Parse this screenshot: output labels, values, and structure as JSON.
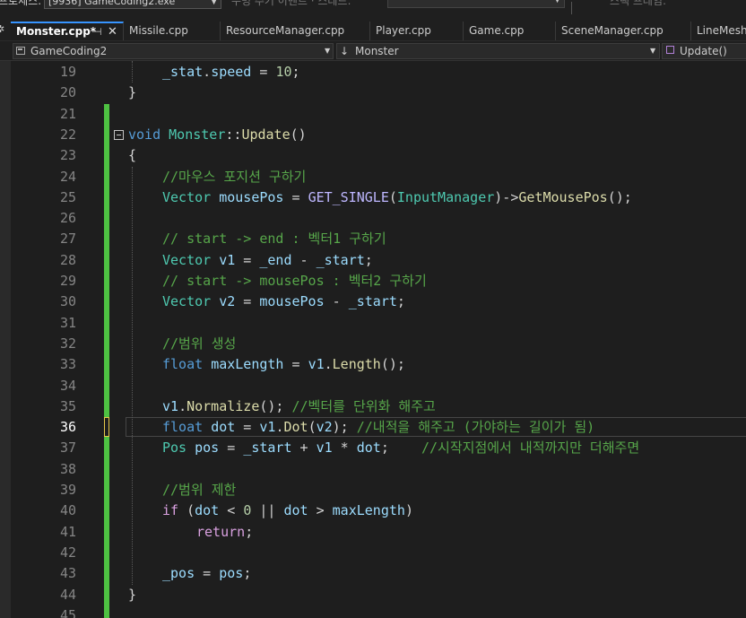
{
  "toolbar": {
    "process_label": "프로세스:",
    "process_value": "[9936] GameCoding2.exe",
    "lifecycle_label": "수명 주기 이벤트 · 스레드:",
    "stack_frame_label": "스택 프레임:"
  },
  "tabs": [
    {
      "label": "Monster.cpp*",
      "active": true
    },
    {
      "label": "Missile.cpp"
    },
    {
      "label": "ResourceManager.cpp"
    },
    {
      "label": "Player.cpp"
    },
    {
      "label": "Game.cpp"
    },
    {
      "label": "SceneManager.cpp"
    },
    {
      "label": "LineMesh."
    }
  ],
  "navbar": {
    "project": "GameCoding2",
    "scope": "Monster",
    "member": "Update()"
  },
  "editor": {
    "current_line": 36,
    "lines": [
      {
        "n": "19",
        "tokens": [
          [
            "var",
            "_stat"
          ],
          [
            "pl",
            "."
          ],
          [
            "var",
            "speed"
          ],
          [
            "pl",
            " = "
          ],
          [
            "num",
            "10"
          ],
          [
            "pl",
            ";"
          ]
        ],
        "indent": 1
      },
      {
        "n": "20",
        "tokens": [
          [
            "pl",
            "}"
          ]
        ],
        "indent": 0
      },
      {
        "n": "21",
        "tokens": [],
        "indent": 0
      },
      {
        "n": "22",
        "tokens": [
          [
            "kw",
            "void"
          ],
          [
            "pl",
            " "
          ],
          [
            "ty",
            "Monster"
          ],
          [
            "pl",
            "::"
          ],
          [
            "fn",
            "Update"
          ],
          [
            "pl",
            "()"
          ]
        ],
        "indent": 0
      },
      {
        "n": "23",
        "tokens": [
          [
            "pl",
            "{"
          ]
        ],
        "indent": 0
      },
      {
        "n": "24",
        "tokens": [
          [
            "cm",
            "//마우스 포지션 구하기"
          ]
        ],
        "indent": 1
      },
      {
        "n": "25",
        "tokens": [
          [
            "ty",
            "Vector"
          ],
          [
            "pl",
            " "
          ],
          [
            "var",
            "mousePos"
          ],
          [
            "pl",
            " = "
          ],
          [
            "mac",
            "GET_SINGLE"
          ],
          [
            "pl",
            "("
          ],
          [
            "ty",
            "InputManager"
          ],
          [
            "pl",
            ")->"
          ],
          [
            "fn",
            "GetMousePos"
          ],
          [
            "pl",
            "();"
          ]
        ],
        "indent": 1
      },
      {
        "n": "26",
        "tokens": [],
        "indent": 0
      },
      {
        "n": "27",
        "tokens": [
          [
            "cm",
            "// start -> end : 벡터1 구하기"
          ]
        ],
        "indent": 1
      },
      {
        "n": "28",
        "tokens": [
          [
            "ty",
            "Vector"
          ],
          [
            "pl",
            " "
          ],
          [
            "var",
            "v1"
          ],
          [
            "pl",
            " = "
          ],
          [
            "var",
            "_end"
          ],
          [
            "pl",
            " - "
          ],
          [
            "var",
            "_start"
          ],
          [
            "pl",
            ";"
          ]
        ],
        "indent": 1
      },
      {
        "n": "29",
        "tokens": [
          [
            "cm",
            "// start -> mousePos : 벡터2 구하기"
          ]
        ],
        "indent": 1
      },
      {
        "n": "30",
        "tokens": [
          [
            "ty",
            "Vector"
          ],
          [
            "pl",
            " "
          ],
          [
            "var",
            "v2"
          ],
          [
            "pl",
            " = "
          ],
          [
            "var",
            "mousePos"
          ],
          [
            "pl",
            " - "
          ],
          [
            "var",
            "_start"
          ],
          [
            "pl",
            ";"
          ]
        ],
        "indent": 1
      },
      {
        "n": "31",
        "tokens": [],
        "indent": 0
      },
      {
        "n": "32",
        "tokens": [
          [
            "cm",
            "//범위 생성"
          ]
        ],
        "indent": 1
      },
      {
        "n": "33",
        "tokens": [
          [
            "kw",
            "float"
          ],
          [
            "pl",
            " "
          ],
          [
            "var",
            "maxLength"
          ],
          [
            "pl",
            " = "
          ],
          [
            "var",
            "v1"
          ],
          [
            "pl",
            "."
          ],
          [
            "fn",
            "Length"
          ],
          [
            "pl",
            "();"
          ]
        ],
        "indent": 1
      },
      {
        "n": "34",
        "tokens": [],
        "indent": 0
      },
      {
        "n": "35",
        "tokens": [
          [
            "var",
            "v1"
          ],
          [
            "pl",
            "."
          ],
          [
            "fn",
            "Normalize"
          ],
          [
            "pl",
            "(); "
          ],
          [
            "cm",
            "//벡터를 단위화 해주고"
          ]
        ],
        "indent": 1
      },
      {
        "n": "36",
        "tokens": [
          [
            "kw",
            "float"
          ],
          [
            "pl",
            " "
          ],
          [
            "var",
            "dot"
          ],
          [
            "pl",
            " = "
          ],
          [
            "var",
            "v1"
          ],
          [
            "pl",
            "."
          ],
          [
            "fn",
            "Dot"
          ],
          [
            "pl",
            "("
          ],
          [
            "var",
            "v2"
          ],
          [
            "pl",
            "); "
          ],
          [
            "cm",
            "//내적을 해주고 (가야하는 길이가 됨)"
          ]
        ],
        "indent": 1
      },
      {
        "n": "37",
        "tokens": [
          [
            "ty",
            "Pos"
          ],
          [
            "pl",
            " "
          ],
          [
            "var",
            "pos"
          ],
          [
            "pl",
            " = "
          ],
          [
            "var",
            "_start"
          ],
          [
            "pl",
            " + "
          ],
          [
            "var",
            "v1"
          ],
          [
            "pl",
            " * "
          ],
          [
            "var",
            "dot"
          ],
          [
            "pl",
            ";    "
          ],
          [
            "cm",
            "//시작지점에서 내적까지만 더해주면"
          ]
        ],
        "indent": 1
      },
      {
        "n": "38",
        "tokens": [],
        "indent": 0
      },
      {
        "n": "39",
        "tokens": [
          [
            "cm",
            "//범위 제한"
          ]
        ],
        "indent": 1
      },
      {
        "n": "40",
        "tokens": [
          [
            "ctrl",
            "if"
          ],
          [
            "pl",
            " ("
          ],
          [
            "var",
            "dot"
          ],
          [
            "pl",
            " < "
          ],
          [
            "num",
            "0"
          ],
          [
            "pl",
            " || "
          ],
          [
            "var",
            "dot"
          ],
          [
            "pl",
            " > "
          ],
          [
            "var",
            "maxLength"
          ],
          [
            "pl",
            ")"
          ]
        ],
        "indent": 1
      },
      {
        "n": "41",
        "tokens": [
          [
            "ctrl",
            "return"
          ],
          [
            "pl",
            ";"
          ]
        ],
        "indent": 2
      },
      {
        "n": "42",
        "tokens": [],
        "indent": 0
      },
      {
        "n": "43",
        "tokens": [
          [
            "var",
            "_pos"
          ],
          [
            "pl",
            " = "
          ],
          [
            "var",
            "pos"
          ],
          [
            "pl",
            ";"
          ]
        ],
        "indent": 1
      },
      {
        "n": "44",
        "tokens": [
          [
            "pl",
            "}"
          ]
        ],
        "indent": 0
      },
      {
        "n": "45",
        "tokens": [],
        "indent": 0
      }
    ]
  }
}
